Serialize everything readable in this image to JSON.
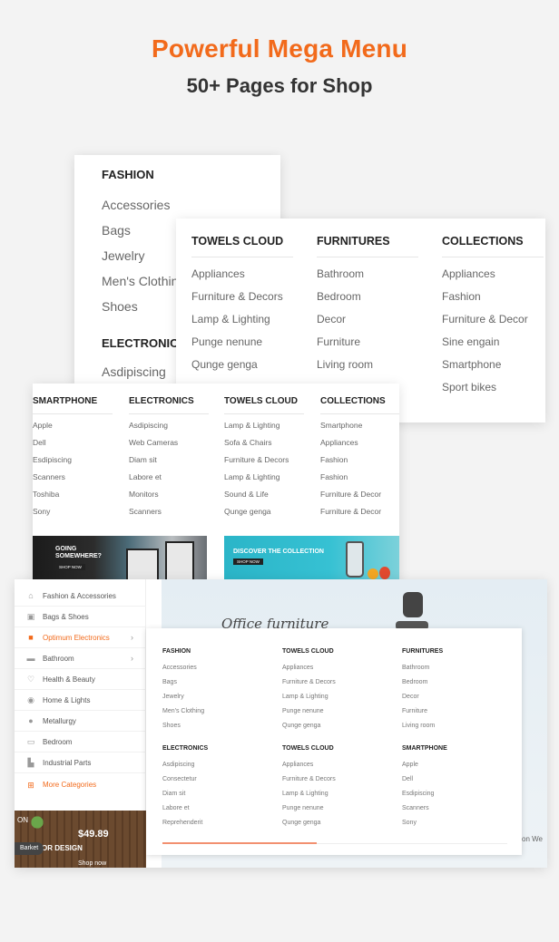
{
  "header": {
    "title": "Powerful Mega Menu",
    "subtitle": "50+ Pages for Shop"
  },
  "colors": {
    "accent": "#f26a1b",
    "text": "#333333",
    "link": "#666666",
    "background": "#f3f3f3"
  },
  "panel_fashion": {
    "sections": [
      {
        "title": "FASHION",
        "items": [
          "Accessories",
          "Bags",
          "Jewelry",
          "Men's Clothing",
          "Shoes"
        ]
      },
      {
        "title": "ELECTRONICS",
        "items": [
          "Asdipiscing"
        ]
      }
    ]
  },
  "panel_towels": {
    "columns": [
      {
        "title": "TOWELS CLOUD",
        "items": [
          "Appliances",
          "Furniture & Decors",
          "Lamp & Lighting",
          "Punge nenune",
          "Qunge genga"
        ]
      },
      {
        "title": "FURNITURES",
        "items": [
          "Bathroom",
          "Bedroom",
          "Decor",
          "Furniture",
          "Living room"
        ]
      },
      {
        "title": "COLLECTIONS",
        "items": [
          "Appliances",
          "Fashion",
          "Furniture & Decor",
          "Sine engain",
          "Smartphone",
          "Sport bikes"
        ]
      }
    ]
  },
  "panel_smartphone": {
    "columns": [
      {
        "title": "SMARTPHONE",
        "items": [
          "Apple",
          "Dell",
          "Esdipiscing",
          "Scanners",
          "Toshiba",
          "Sony"
        ]
      },
      {
        "title": "ELECTRONICS",
        "items": [
          "Asdipiscing",
          "Web Cameras",
          "Diam sit",
          "Labore et",
          "Monitors",
          "Scanners"
        ]
      },
      {
        "title": "TOWELS CLOUD",
        "items": [
          "Lamp & Lighting",
          "Sofa & Chairs",
          "Furniture & Decors",
          "Lamp & Lighting",
          "Sound & Life",
          "Qunge genga"
        ]
      },
      {
        "title": "COLLECTIONS",
        "items": [
          "Smartphone",
          "Appliances",
          "Fashion",
          "Fashion",
          "Furniture & Decor",
          "Furniture & Decor"
        ]
      }
    ],
    "banners": [
      {
        "line1": "GOING",
        "line2": "SOMEWHERE?",
        "button": "SHOP NOW"
      },
      {
        "line1": "DISCOVER THE COLLECTION",
        "button": "SHOP NOW"
      }
    ]
  },
  "panel_office": {
    "sidebar": [
      {
        "label": "Fashion & Accessories",
        "icon": "hanger-icon",
        "active": false,
        "arrow": false
      },
      {
        "label": "Bags & Shoes",
        "icon": "bag-icon",
        "active": false,
        "arrow": false
      },
      {
        "label": "Optimum Electronics",
        "icon": "camera-icon",
        "active": true,
        "arrow": true
      },
      {
        "label": "Bathroom",
        "icon": "bathtub-icon",
        "active": false,
        "arrow": true
      },
      {
        "label": "Health & Beauty",
        "icon": "heart-pulse-icon",
        "active": false,
        "arrow": false
      },
      {
        "label": "Home & Lights",
        "icon": "lamp-icon",
        "active": false,
        "arrow": false
      },
      {
        "label": "Metallurgy",
        "icon": "drop-icon",
        "active": false,
        "arrow": false
      },
      {
        "label": "Bedroom",
        "icon": "bed-icon",
        "active": false,
        "arrow": false
      },
      {
        "label": "Industrial Parts",
        "icon": "factory-icon",
        "active": false,
        "arrow": false
      }
    ],
    "more_categories": "More Categories",
    "promo": {
      "logo_fragment": "ON",
      "price": "$49.89",
      "caption": "NTERIOR DESIGN",
      "shop": "Shop now",
      "tag": "Barket"
    },
    "hero": {
      "title": "Office furniture",
      "caption": "on We"
    },
    "mega_columns": [
      {
        "title": "FASHION",
        "items": [
          "Accessories",
          "Bags",
          "Jewelry",
          "Men's Clothing",
          "Shoes"
        ]
      },
      {
        "title": "TOWELS CLOUD",
        "items": [
          "Appliances",
          "Furniture & Decors",
          "Lamp & Lighting",
          "Punge nenune",
          "Qunge genga"
        ]
      },
      {
        "title": "FURNITURES",
        "items": [
          "Bathroom",
          "Bedroom",
          "Decor",
          "Furniture",
          "Living room"
        ]
      },
      {
        "title": "ELECTRONICS",
        "items": [
          "Asdipiscing",
          "Consectetur",
          "Diam sit",
          "Labore et",
          "Reprehenderit"
        ]
      },
      {
        "title": "TOWELS CLOUD",
        "items": [
          "Appliances",
          "Furniture & Decors",
          "Lamp & Lighting",
          "Punge nenune",
          "Qunge genga"
        ]
      },
      {
        "title": "SMARTPHONE",
        "items": [
          "Apple",
          "Dell",
          "Esdipiscing",
          "Scanners",
          "Sony"
        ]
      }
    ]
  }
}
